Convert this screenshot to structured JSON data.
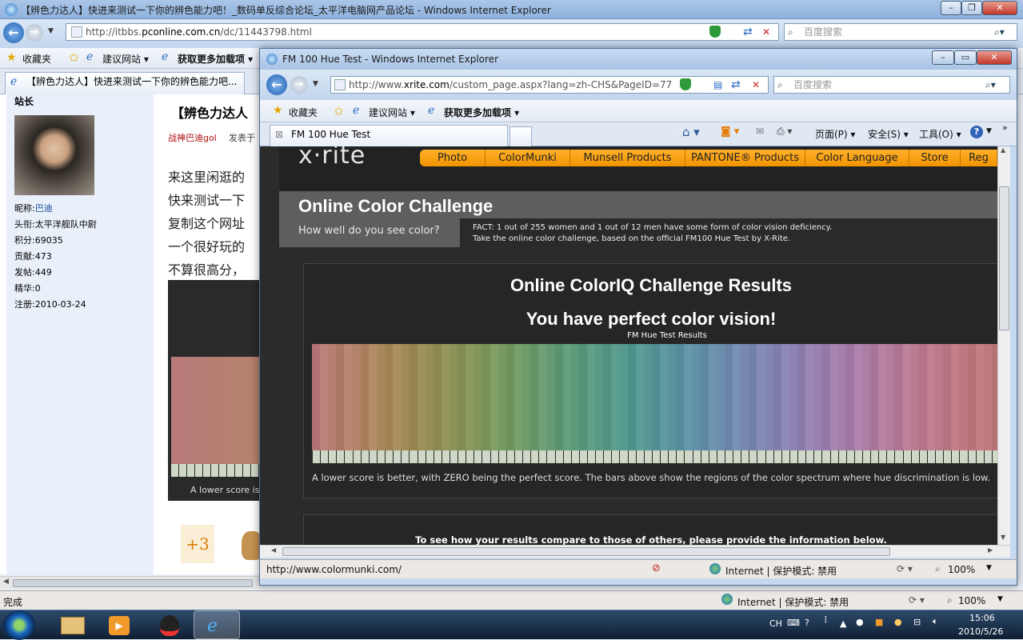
{
  "back_window": {
    "title": "【辨色力达人】快进来测试一下你的辨色能力吧！_数码单反综合论坛_太平洋电脑网产品论坛 - Windows Internet Explorer",
    "url": "http://itbbs.pconline.com.cn/dc/11443798.html",
    "url_host": "pconline.com.cn",
    "url_prefix": "http://itbbs.",
    "url_suffix": "/dc/11443798.html",
    "search_placeholder": "百度搜索",
    "favorites": {
      "label": "收藏夹",
      "suggested": "建议网站 ▾",
      "addons": "获取更多加载项 ▾"
    },
    "tab_label": "【辨色力达人】快进来测试一下你的辨色能力吧...",
    "profile": {
      "rank": "站长",
      "fields": [
        {
          "k": "昵称:",
          "v": "巴迪"
        },
        {
          "k": "头衔:",
          "v": "太平洋舰队中尉"
        },
        {
          "k": "积分:",
          "v": "69035"
        },
        {
          "k": "贡献:",
          "v": "473"
        },
        {
          "k": "发帖:",
          "v": "449"
        },
        {
          "k": "精华:",
          "v": "0"
        },
        {
          "k": "注册:",
          "v": "2010-03-24"
        }
      ]
    },
    "post": {
      "title": "【辨色力达人",
      "author": "战神巴迪gol",
      "posted": "发表于",
      "lines": [
        "来这里闲逛的",
        "快来测试一下",
        "复制这个网址",
        "一个很好玩的",
        "不算很高分，"
      ],
      "caption": "A lower score is",
      "plus": "+3"
    },
    "status": {
      "done": "完成",
      "zone": "Internet | 保护模式: 禁用",
      "zoom": "100%"
    }
  },
  "front_window": {
    "title": "FM 100 Hue Test - Windows Internet Explorer",
    "url_prefix": "http://www.",
    "url_host": "xrite.com",
    "url_suffix": "/custom_page.aspx?lang=zh-CHS&PageID=77",
    "search_placeholder": "百度搜索",
    "favorites": {
      "label": "收藏夹",
      "suggested": "建议网站 ▾",
      "addons": "获取更多加载项 ▾"
    },
    "tab_label": "FM 100 Hue Test",
    "commands": {
      "page": "页面(P) ▾",
      "safety": "安全(S) ▾",
      "tools": "工具(O) ▾"
    },
    "status": {
      "url": "http://www.colormunki.com/",
      "zone": "Internet | 保护模式: 禁用",
      "zoom": "100%"
    }
  },
  "page": {
    "logo": "x·rite",
    "menu": [
      "Photo",
      "ColorMunki",
      "Munsell Products",
      "PANTONE® Products",
      "Color Language",
      "Store",
      "Reg"
    ],
    "heading": "Online Color Challenge",
    "subheading": "How well do you see color?",
    "fact1": "FACT: 1 out of 255 women and 1 out of 12 men have some form of color vision deficiency.",
    "fact2": "Take the online color challenge, based on the official FM100 Hue Test by X-Rite.",
    "results_title": "Online ColorIQ Challenge Results",
    "results_verdict": "You have perfect color vision!",
    "chart_title": "FM Hue Test Results",
    "caption": "A lower score is better, with ZERO being the perfect score. The bars above show the regions of the color spectrum where hue discrimination is low.",
    "compare": "To see how your results compare to those of others, please provide the information below."
  },
  "chart_data": {
    "type": "bar",
    "title": "FM Hue Test Results",
    "description_visible": "hue spectrum strip, all scores zero",
    "categories_count": 85,
    "values_all_zero": true,
    "spectrum_colors": [
      "#b87a7a",
      "#b4826a",
      "#a88a5a",
      "#9a8c55",
      "#8a9358",
      "#7a9a5e",
      "#6c9b6a",
      "#5f9a78",
      "#579a86",
      "#559893",
      "#5a939f",
      "#6690ab",
      "#7789b0",
      "#8783b2",
      "#9880b0",
      "#a87ea8",
      "#b47c9c",
      "#bb7a8e",
      "#bd7883",
      "#bf7a7c"
    ]
  },
  "taskbar": {
    "clock_time": "15:06",
    "clock_date": "2010/5/26",
    "lang": "CH"
  }
}
